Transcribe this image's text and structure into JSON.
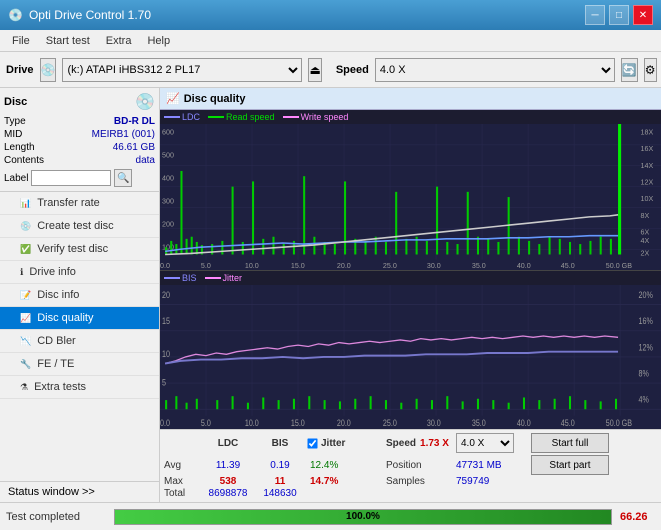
{
  "titlebar": {
    "title": "Opti Drive Control 1.70",
    "icon": "💿",
    "btn_minimize": "─",
    "btn_maximize": "□",
    "btn_close": "✕"
  },
  "menubar": {
    "items": [
      "File",
      "Start test",
      "Extra",
      "Help"
    ]
  },
  "drivebar": {
    "label": "Drive",
    "drive_value": "(k:) ATAPI iHBS312  2 PL17",
    "speed_label": "Speed",
    "speed_value": "4.0 X"
  },
  "disc_panel": {
    "title": "Disc",
    "type_label": "Type",
    "type_value": "BD-R DL",
    "mid_label": "MID",
    "mid_value": "MEIRB1 (001)",
    "length_label": "Length",
    "length_value": "46.61 GB",
    "contents_label": "Contents",
    "contents_value": "data",
    "label_label": "Label"
  },
  "nav": {
    "items": [
      {
        "id": "transfer-rate",
        "label": "Transfer rate"
      },
      {
        "id": "create-test-disc",
        "label": "Create test disc"
      },
      {
        "id": "verify-test-disc",
        "label": "Verify test disc"
      },
      {
        "id": "drive-info",
        "label": "Drive info"
      },
      {
        "id": "disc-info",
        "label": "Disc info"
      },
      {
        "id": "disc-quality",
        "label": "Disc quality",
        "active": true
      },
      {
        "id": "cd-bler",
        "label": "CD Bler"
      },
      {
        "id": "fe-te",
        "label": "FE / TE"
      },
      {
        "id": "extra-tests",
        "label": "Extra tests"
      }
    ]
  },
  "disc_quality": {
    "panel_title": "Disc quality",
    "legend": {
      "ldc": "LDC",
      "read_speed": "Read speed",
      "write_speed": "Write speed",
      "bis": "BIS",
      "jitter": "Jitter"
    },
    "top_chart": {
      "y_left_max": 600,
      "y_right_labels": [
        "18X",
        "16X",
        "14X",
        "12X",
        "10X",
        "8X",
        "6X",
        "4X",
        "2X"
      ],
      "x_labels": [
        "0.0",
        "5.0",
        "10.0",
        "15.0",
        "20.0",
        "25.0",
        "30.0",
        "35.0",
        "40.0",
        "45.0",
        "50.0 GB"
      ]
    },
    "bottom_chart": {
      "y_left_max": 20,
      "y_right_labels": [
        "20%",
        "16%",
        "12%",
        "8%",
        "4%"
      ],
      "x_labels": [
        "0.0",
        "5.0",
        "10.0",
        "15.0",
        "20.0",
        "25.0",
        "30.0",
        "35.0",
        "40.0",
        "45.0",
        "50.0 GB"
      ]
    },
    "stats": {
      "headers": [
        "LDC",
        "BIS",
        "",
        "Jitter",
        "Speed",
        ""
      ],
      "avg_label": "Avg",
      "avg_ldc": "11.39",
      "avg_bis": "0.19",
      "avg_jitter": "12.4%",
      "max_label": "Max",
      "max_ldc": "538",
      "max_bis": "11",
      "max_jitter": "14.7%",
      "total_label": "Total",
      "total_ldc": "8698878",
      "total_bis": "148630",
      "speed_label": "Speed",
      "speed_value": "1.73 X",
      "position_label": "Position",
      "position_value": "47731 MB",
      "samples_label": "Samples",
      "samples_value": "759749",
      "speed_select": "4.0 X"
    },
    "buttons": {
      "start_full": "Start full",
      "start_part": "Start part"
    }
  },
  "statusbar": {
    "nav_label": "Status window >>",
    "status_text": "Test completed",
    "progress": 100,
    "progress_text": "100.0%",
    "score": "66.26"
  }
}
